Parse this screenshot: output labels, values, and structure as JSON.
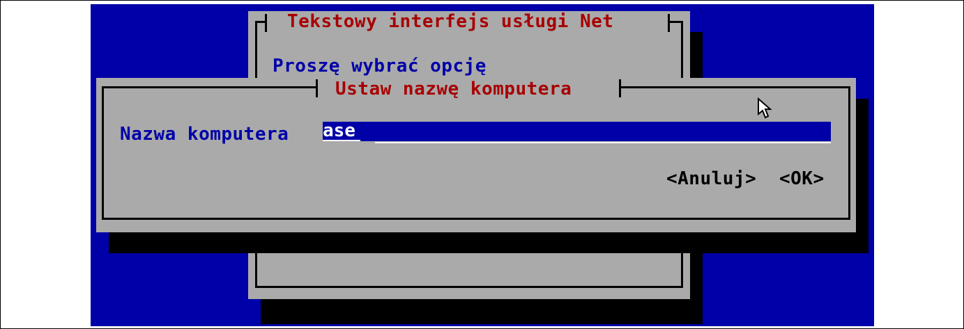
{
  "background_dialog": {
    "title": "Tekstowy interfejs usługi Net",
    "prompt": "Proszę wybrać opcję"
  },
  "hostname_dialog": {
    "title": "Ustaw nazwę komputera",
    "field_label": "Nazwa komputera",
    "field_value": "ase",
    "cancel_label": "<Anuluj>",
    "ok_label": "<OK>"
  },
  "colors": {
    "screen_background": "#0000a8",
    "dialog_background": "#aaaaaa",
    "title_text": "#a80000",
    "label_text": "#0000a8",
    "shadow": "#000000"
  }
}
